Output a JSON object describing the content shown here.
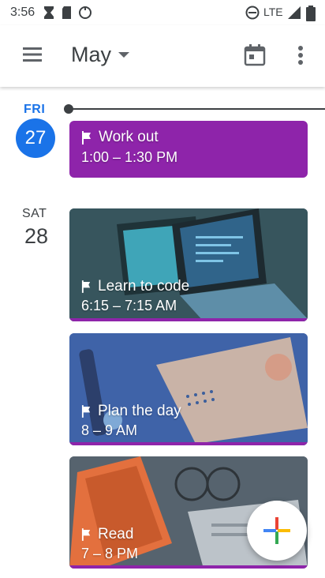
{
  "status_bar": {
    "time": "3:56",
    "network": "LTE"
  },
  "header": {
    "month": "May"
  },
  "days": [
    {
      "dow": "FRI",
      "date": "27"
    },
    {
      "dow": "SAT",
      "date": "28"
    }
  ],
  "events": [
    {
      "title": "Work out",
      "time": "1:00 – 1:30 PM"
    },
    {
      "title": "Learn to code",
      "time": "6:15 – 7:15 AM"
    },
    {
      "title": "Plan the day",
      "time": "8 – 9 AM"
    },
    {
      "title": "Read",
      "time": "7 – 8 PM"
    }
  ],
  "colors": {
    "accent": "#1a73e8",
    "event_purple": "#8e24aa",
    "text": "#3c4043"
  },
  "icons": [
    "hourglass-icon",
    "sd-card-icon",
    "sync-icon",
    "dnd-icon",
    "signal-icon",
    "battery-icon",
    "menu-icon",
    "dropdown-icon",
    "calendar-today-icon",
    "more-vert-icon",
    "flag-icon",
    "add-icon"
  ]
}
